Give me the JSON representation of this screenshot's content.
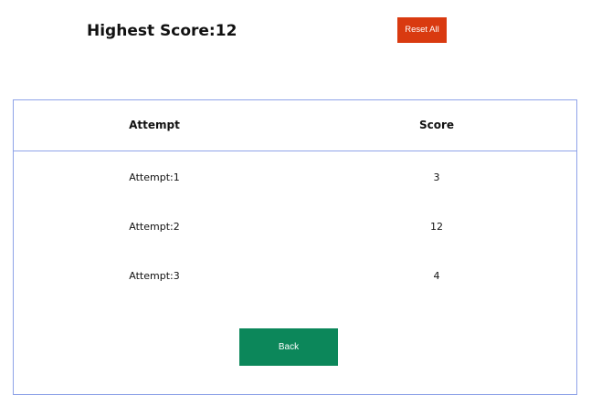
{
  "header": {
    "highest_score_label": "Highest Score:",
    "highest_score_value": "12",
    "reset_label": "Reset All"
  },
  "table": {
    "columns": [
      "Attempt",
      "Score"
    ],
    "rows": [
      {
        "attempt": "Attempt:1",
        "score": "3"
      },
      {
        "attempt": "Attempt:2",
        "score": "12"
      },
      {
        "attempt": "Attempt:3",
        "score": "4"
      }
    ]
  },
  "footer": {
    "back_label": "Back"
  },
  "colors": {
    "reset_button": "#d93a10",
    "back_button": "#0c875a",
    "panel_border": "#8fa3e8"
  }
}
